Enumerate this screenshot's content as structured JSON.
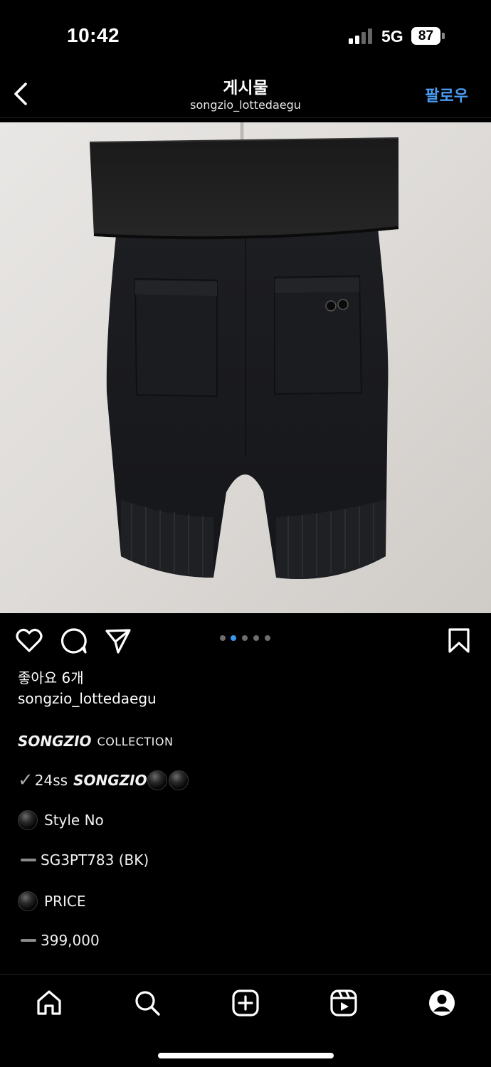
{
  "status_bar": {
    "time": "10:42",
    "network": "5G",
    "battery": "87",
    "icons": [
      "signal-icon",
      "battery-icon"
    ]
  },
  "header": {
    "title": "게시물",
    "username": "songzio_lottedaegu",
    "follow_label": "팔로우",
    "back_icon": "chevron-left-icon",
    "accent_color": "#4a9cf2"
  },
  "post": {
    "image_subject": "black knit shorts with fold-over waistband",
    "carousel_total": 5,
    "carousel_active": 2,
    "active_dot_color": "#3897f0",
    "likes": "좋아요 6개",
    "author": "songzio_lottedaegu",
    "caption": {
      "line1_brand": "SONGZIO",
      "line1_rest": "COLLECTION",
      "line2_prefix": "24ss",
      "line2_brand": "SONGZIO",
      "line3": "Style No",
      "line4": "SG3PT783 (BK)",
      "line5": "PRICE",
      "line6": "399,000"
    }
  },
  "actions": [
    "heart-icon",
    "comment-icon",
    "share-icon",
    "bookmark-icon"
  ],
  "bottom_nav": [
    "home-icon",
    "search-icon",
    "create-icon",
    "reels-icon",
    "profile-icon"
  ]
}
